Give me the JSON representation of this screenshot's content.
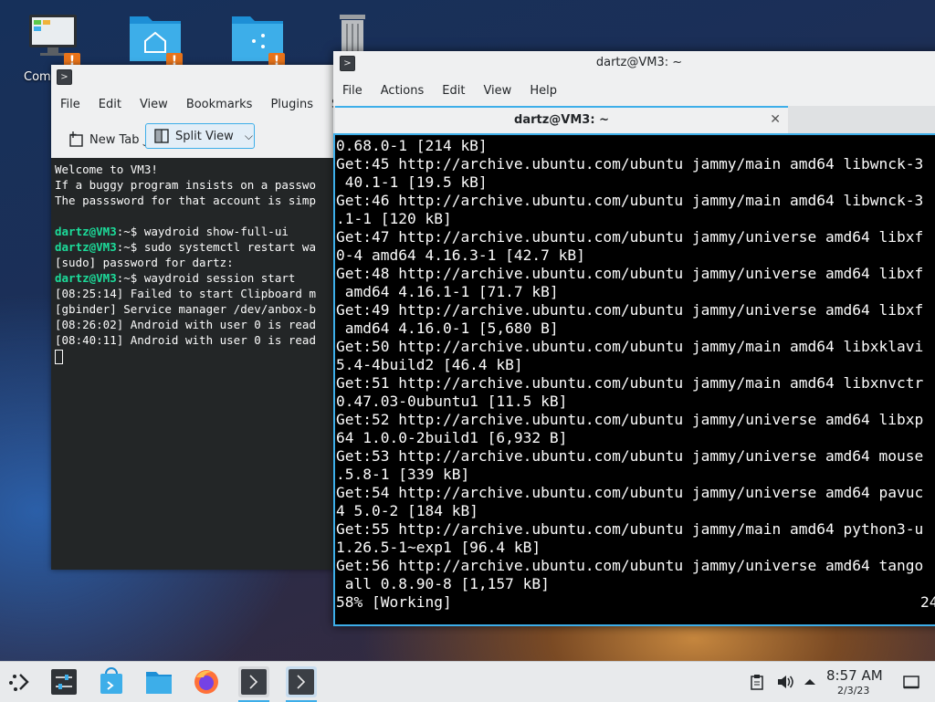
{
  "desktop": {
    "icons": [
      {
        "name": "computer",
        "label": "Comp"
      },
      {
        "name": "home-folder"
      },
      {
        "name": "folder"
      },
      {
        "name": "trash"
      }
    ],
    "emblem_glyph": "!"
  },
  "back_window": {
    "menu": [
      "File",
      "Edit",
      "View",
      "Bookmarks",
      "Plugins",
      "Se"
    ],
    "new_tab_label": "New Tab",
    "split_view_label": "Split View",
    "lines": [
      {
        "text": "Welcome to VM3!"
      },
      {
        "text": "If a buggy program insists on a passwo"
      },
      {
        "text": "The passsword for that account is simp"
      },
      {
        "text": ""
      },
      {
        "prompt": "dartz@VM3",
        "cmd": ":~$ waydroid show-full-ui"
      },
      {
        "prompt": "dartz@VM3",
        "cmd": ":~$ sudo systemctl restart wa"
      },
      {
        "text": "[sudo] password for dartz:"
      },
      {
        "prompt": "dartz@VM3",
        "cmd": ":~$ waydroid session start"
      },
      {
        "text": "[08:25:14] Failed to start Clipboard m"
      },
      {
        "text": "[gbinder] Service manager /dev/anbox-b"
      },
      {
        "text": "[08:26:02] Android with user 0 is read"
      },
      {
        "text": "[08:40:11] Android with user 0 is read"
      }
    ]
  },
  "front_window": {
    "title": "dartz@VM3: ~",
    "menu": [
      "File",
      "Actions",
      "Edit",
      "View",
      "Help"
    ],
    "tab_label": "dartz@VM3: ~",
    "close_glyph": "✕",
    "lines": [
      "0.68.0-1 [214 kB]",
      "Get:45 http://archive.ubuntu.com/ubuntu jammy/main amd64 libwnck-3",
      " 40.1-1 [19.5 kB]",
      "Get:46 http://archive.ubuntu.com/ubuntu jammy/main amd64 libwnck-3",
      ".1-1 [120 kB]",
      "Get:47 http://archive.ubuntu.com/ubuntu jammy/universe amd64 libxf",
      "0-4 amd64 4.16.3-1 [42.7 kB]",
      "Get:48 http://archive.ubuntu.com/ubuntu jammy/universe amd64 libxf",
      " amd64 4.16.1-1 [71.7 kB]",
      "Get:49 http://archive.ubuntu.com/ubuntu jammy/universe amd64 libxf",
      " amd64 4.16.0-1 [5,680 B]",
      "Get:50 http://archive.ubuntu.com/ubuntu jammy/main amd64 libxklavi",
      "5.4-4build2 [46.4 kB]",
      "Get:51 http://archive.ubuntu.com/ubuntu jammy/main amd64 libxnvctr",
      "0.47.03-0ubuntu1 [11.5 kB]",
      "Get:52 http://archive.ubuntu.com/ubuntu jammy/universe amd64 libxp",
      "64 1.0.0-2build1 [6,932 B]",
      "Get:53 http://archive.ubuntu.com/ubuntu jammy/universe amd64 mouse",
      ".5.8-1 [339 kB]",
      "Get:54 http://archive.ubuntu.com/ubuntu jammy/universe amd64 pavuc",
      "4 5.0-2 [184 kB]",
      "Get:55 http://archive.ubuntu.com/ubuntu jammy/main amd64 python3-u",
      "1.26.5-1~exp1 [96.4 kB]",
      "Get:56 http://archive.ubuntu.com/ubuntu jammy/universe amd64 tango",
      " all 0.8.90-8 [1,157 kB]"
    ],
    "status_left": "58% [Working]",
    "status_right": "24"
  },
  "taskbar": {
    "items": [
      "app-launcher",
      "system-settings",
      "discover",
      "file-manager",
      "firefox",
      "konsole-1",
      "konsole-2"
    ],
    "tray": [
      "clipboard",
      "volume",
      "expand-tray"
    ],
    "time": "8:57 AM",
    "date": "2/3/23"
  },
  "colors": {
    "accent": "#3daee9",
    "prompt": "#1cdc9a",
    "emblem": "#e8731a"
  }
}
